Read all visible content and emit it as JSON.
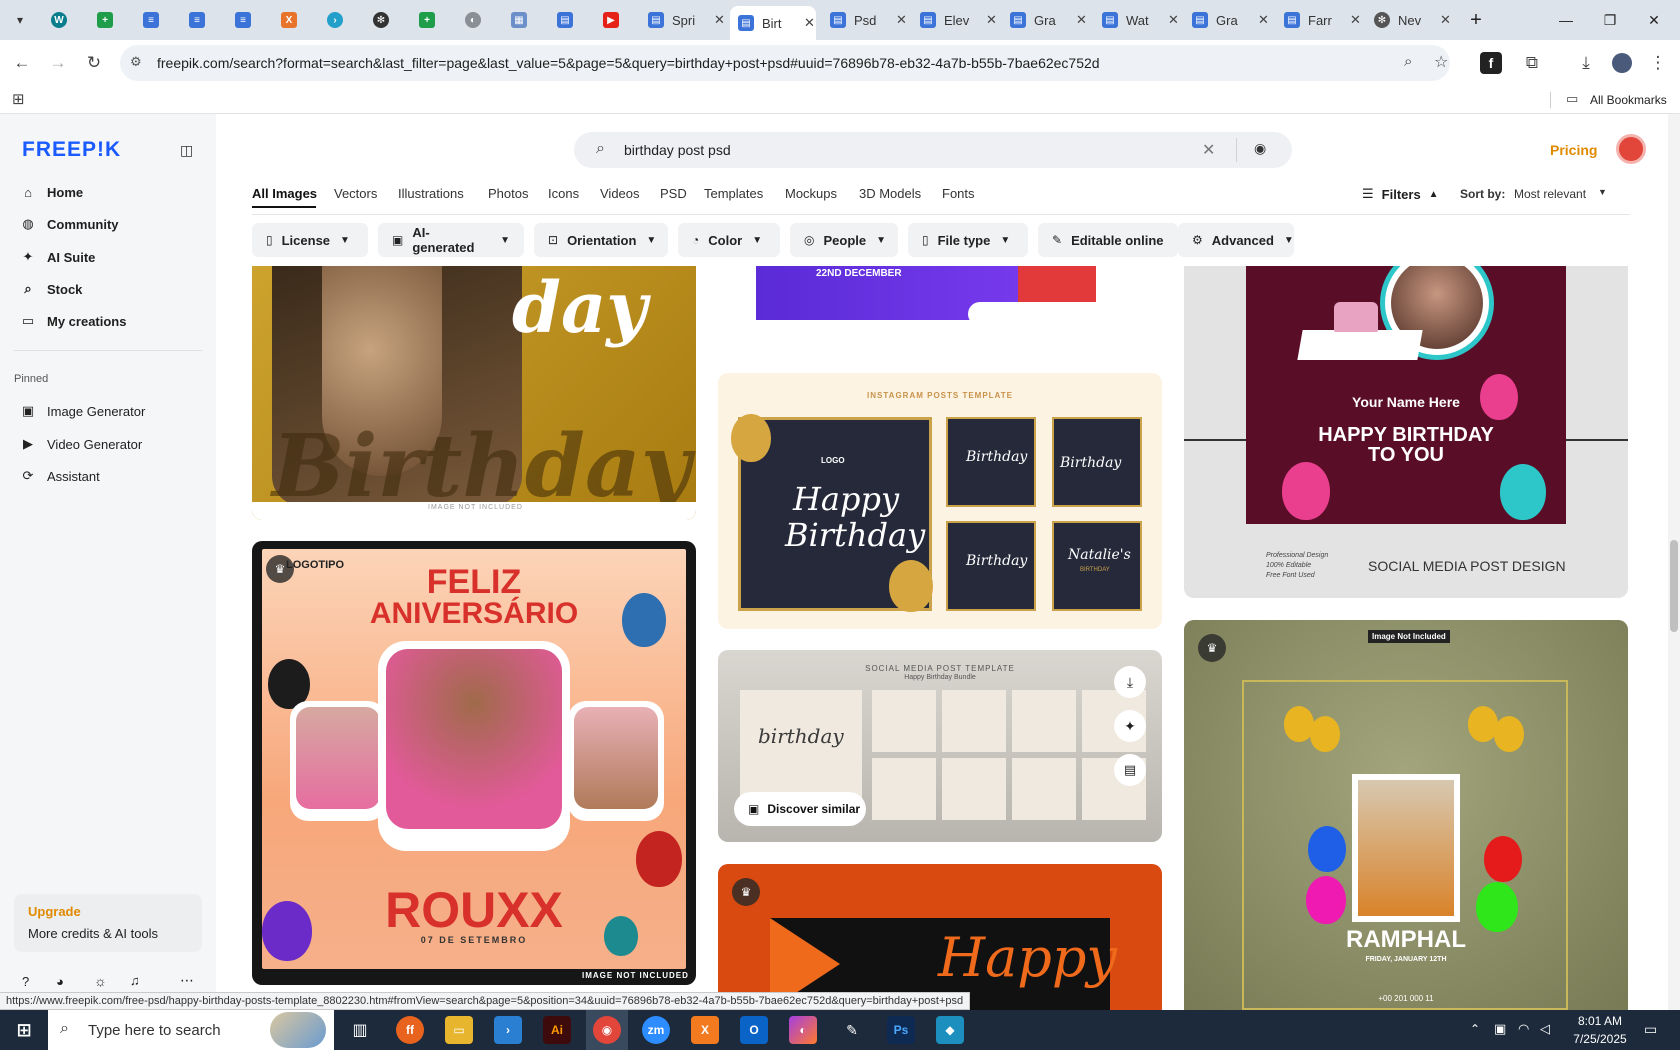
{
  "browser": {
    "tabs": [
      {
        "title": "Spri"
      },
      {
        "title": "Birt",
        "active": true
      },
      {
        "title": "Psd"
      },
      {
        "title": "Elev"
      },
      {
        "title": "Gra"
      },
      {
        "title": "Wat"
      },
      {
        "title": "Gra"
      },
      {
        "title": "Farr"
      },
      {
        "title": "Nev"
      }
    ],
    "url": "freepik.com/search?format=search&last_filter=page&last_value=5&page=5&query=birthday+post+psd#uuid=76896b78-eb32-4a7b-b55b-7bae62ec752d",
    "all_bookmarks": "All Bookmarks",
    "status_url": "https://www.freepik.com/free-psd/happy-birthday-posts-template_8802230.htm#fromView=search&page=5&position=34&uuid=76896b78-eb32-4a7b-b55b-7bae62ec752d&query=birthday+post+psd"
  },
  "sidebar": {
    "logo": "FREEP!K",
    "nav": [
      {
        "label": "Home",
        "icon": "home-icon"
      },
      {
        "label": "Community",
        "icon": "globe-icon"
      },
      {
        "label": "AI Suite",
        "icon": "sparkle-icon"
      },
      {
        "label": "Stock",
        "icon": "search-icon"
      },
      {
        "label": "My creations",
        "icon": "folder-icon"
      }
    ],
    "pinned_label": "Pinned",
    "pinned": [
      {
        "label": "Image Generator",
        "icon": "image-icon"
      },
      {
        "label": "Video Generator",
        "icon": "video-icon"
      },
      {
        "label": "Assistant",
        "icon": "assistant-icon"
      }
    ],
    "upgrade_title": "Upgrade",
    "upgrade_text": "More credits & AI tools"
  },
  "header": {
    "search_query": "birthday post psd",
    "pricing": "Pricing",
    "categories": [
      "All Images",
      "Vectors",
      "Illustrations",
      "Photos",
      "Icons",
      "Videos",
      "PSD",
      "Templates",
      "Mockups",
      "3D Models",
      "Fonts"
    ],
    "filters_label": "Filters",
    "sort_label": "Sort by:",
    "sort_value": "Most relevant"
  },
  "filters": [
    {
      "label": "License"
    },
    {
      "label": "AI-generated"
    },
    {
      "label": "Orientation"
    },
    {
      "label": "Color"
    },
    {
      "label": "People"
    },
    {
      "label": "File type"
    },
    {
      "label": "Editable online"
    },
    {
      "label": "Advanced"
    }
  ],
  "cards": {
    "c1": {
      "word": "day",
      "script": "Birthday",
      "note": "IMAGE NOT INCLUDED"
    },
    "c2": {
      "logo": "LOGOTIPO",
      "title1": "FELIZ",
      "title2": "ANIVERSÁRIO",
      "name": "ROUXX",
      "date": "07 DE SETEMBRO",
      "note": "IMAGE NOT INCLUDED"
    },
    "c3": {
      "date": "22ND DECEMBER"
    },
    "c4": {
      "header": "INSTAGRAM POSTS TEMPLATE",
      "main_logo": "LOGO",
      "main1": "Happy",
      "main2": "Birthday",
      "s1": "Birthday",
      "s2": "Birthday",
      "s3": "Birthday",
      "s4": "Natalie's",
      "s4b": "BIRTHDAY"
    },
    "c5": {
      "header": "SOCIAL MEDIA POST TEMPLATE",
      "sub": "Happy Birthday Bundle",
      "main": "birthday",
      "discover": "Discover similar"
    },
    "c6": {
      "script": "Happy"
    },
    "c7": {
      "name": "Your Name Here",
      "title1": "HAPPY BIRTHDAY",
      "title2": "TO YOU",
      "f1": "Professional Design",
      "f2": "100% Editable",
      "f3": "Free Font Used",
      "caption": "SOCIAL MEDIA POST DESIGN"
    },
    "c8": {
      "note": "Image Not Included",
      "name": "RAMPHAL",
      "date": "FRIDAY, JANUARY 12TH",
      "phone": "+00 201 000 11"
    }
  },
  "taskbar": {
    "search_placeholder": "Type here to search",
    "time": "8:01 AM",
    "date": "7/25/2025"
  }
}
